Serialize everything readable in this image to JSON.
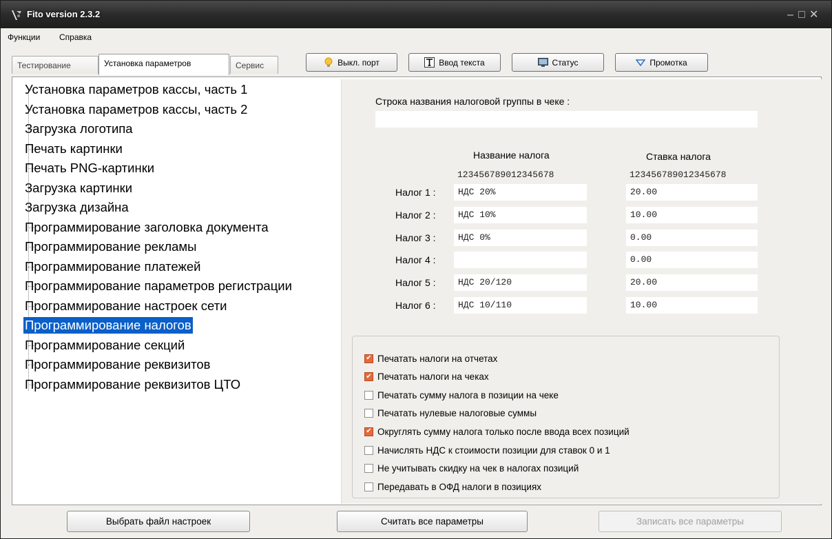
{
  "window": {
    "title": "Fito version 2.3.2"
  },
  "menu": [
    "Функции",
    "Справка"
  ],
  "tabs": [
    "Тестирование",
    "Установка параметров",
    "Сервис"
  ],
  "toolbar": {
    "port": "Выкл. порт",
    "text_input": "Ввод текста",
    "status": "Статус",
    "feed": "Промотка"
  },
  "tree": {
    "items": [
      "Установка параметров кассы, часть 1",
      "Установка параметров кассы, часть 2",
      "Загрузка логотипа",
      "Печать картинки",
      "Печать PNG-картинки",
      "Загрузка картинки",
      "Загрузка дизайна",
      "Программирование заголовка документа",
      "Программирование рекламы",
      "Программирование платежей",
      "Программирование параметров регистрации",
      "Программирование настроек сети",
      "Программирование налогов",
      "Программирование секций",
      "Программирование реквизитов",
      "Программирование реквизитов ЦТО"
    ],
    "selected": "Программирование налогов"
  },
  "tax": {
    "group_label": "Строка названия налоговой группы  в чеке :",
    "group_value": "",
    "name_header": "Название налога",
    "rate_header": "Ставка налога",
    "ruler": "123456789012345678",
    "rows": [
      {
        "label": "Налог 1 :",
        "name": "НДС 20%",
        "rate": "20.00"
      },
      {
        "label": "Налог 2 :",
        "name": "НДС 10%",
        "rate": "10.00"
      },
      {
        "label": "Налог 3 :",
        "name": "НДС 0%",
        "rate": "0.00"
      },
      {
        "label": "Налог 4 :",
        "name": "",
        "rate": "0.00"
      },
      {
        "label": "Налог 5 :",
        "name": "НДС 20/120",
        "rate": "20.00"
      },
      {
        "label": "Налог 6 :",
        "name": "НДС 10/110",
        "rate": "10.00"
      }
    ]
  },
  "options": [
    {
      "label": "Печатать налоги на отчетах",
      "checked": true
    },
    {
      "label": "Печатать налоги на чеках",
      "checked": true
    },
    {
      "label": "Печатать сумму налога в позиции на чеке",
      "checked": false
    },
    {
      "label": "Печатать нулевые налоговые суммы",
      "checked": false
    },
    {
      "label": "Округлять сумму налога только после ввода всех позиций",
      "checked": true
    },
    {
      "label": "Начислять НДС к стоимости позиции для ставок 0 и 1",
      "checked": false
    },
    {
      "label": "Не учитывать скидку на чек в налогах позиций",
      "checked": false
    },
    {
      "label": "Передавать в ОФД налоги в позициях",
      "checked": false
    }
  ],
  "bottom": {
    "choose_file": "Выбрать файл настроек",
    "read_all": "Считать все параметры",
    "write_all": "Записать все параметры"
  },
  "colors": {
    "selection": "#0a5fc9",
    "checkbox_checked": "#e46a3c",
    "titlebar": "#2b2b2b"
  }
}
